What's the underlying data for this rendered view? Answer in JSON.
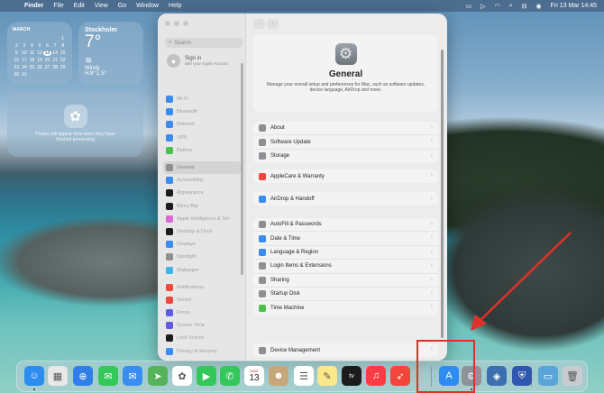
{
  "menubar": {
    "app": "Finder",
    "items": [
      "File",
      "Edit",
      "View",
      "Go",
      "Window",
      "Help"
    ],
    "datetime": "Fri 13 Mar  14:45"
  },
  "calendar_widget": {
    "month": "MARCH",
    "days": [
      "1",
      "2",
      "3",
      "4",
      "5",
      "6",
      "7",
      "8",
      "9",
      "10",
      "11",
      "12",
      "13",
      "14",
      "15",
      "16",
      "17",
      "18",
      "19",
      "20",
      "21",
      "22",
      "23",
      "24",
      "25",
      "26",
      "27",
      "28",
      "29",
      "30",
      "31"
    ],
    "today": "13"
  },
  "weather_widget": {
    "city": "Stockholm",
    "temp": "7°",
    "condition": "Windy",
    "high_low": "H:8° L:5°"
  },
  "photos_widget": {
    "message": "Photos will appear here when they have finished processing"
  },
  "settings": {
    "search_placeholder": "Search",
    "signin": {
      "title": "Sign in",
      "subtitle": "with your Apple Account"
    },
    "sidebar": [
      {
        "label": "Wi-Fi",
        "color": "#3a8cf0"
      },
      {
        "label": "Bluetooth",
        "color": "#3a8cf0"
      },
      {
        "label": "Network",
        "color": "#3a8cf0"
      },
      {
        "label": "VPN",
        "color": "#3a8cf0"
      },
      {
        "label": "Battery",
        "color": "#4cc04f"
      },
      {
        "label": "General",
        "color": "#8e8e93",
        "active": true
      },
      {
        "label": "Accessibility",
        "color": "#3a8cf0"
      },
      {
        "label": "Appearance",
        "color": "#1c1c1e"
      },
      {
        "label": "Menu Bar",
        "color": "#1c1c1e"
      },
      {
        "label": "Apple Intelligence & Siri",
        "color": "#d86bd8"
      },
      {
        "label": "Desktop & Dock",
        "color": "#1c1c1e"
      },
      {
        "label": "Displays",
        "color": "#3a8cf0"
      },
      {
        "label": "Spotlight",
        "color": "#8e8e93"
      },
      {
        "label": "Wallpaper",
        "color": "#40b4e6"
      },
      {
        "label": "Notifications",
        "color": "#f0483e"
      },
      {
        "label": "Sound",
        "color": "#f0483e"
      },
      {
        "label": "Focus",
        "color": "#5e5ce6"
      },
      {
        "label": "Screen Time",
        "color": "#5e5ce6"
      },
      {
        "label": "Lock Screen",
        "color": "#1c1c1e"
      },
      {
        "label": "Privacy & Security",
        "color": "#3a8cf0"
      }
    ],
    "general": {
      "title": "General",
      "description": "Manage your overall setup and preferences for Mac, such as software updates, device language, AirDrop and more."
    },
    "groups": [
      [
        {
          "label": "About",
          "color": "#8e8e93"
        },
        {
          "label": "Software Update",
          "color": "#8e8e93"
        },
        {
          "label": "Storage",
          "color": "#8e8e93"
        }
      ],
      [
        {
          "label": "AppleCare & Warranty",
          "color": "#f0483e"
        }
      ],
      [
        {
          "label": "AirDrop & Handoff",
          "color": "#3a8cf0"
        }
      ],
      [
        {
          "label": "AutoFill & Passwords",
          "color": "#8e8e93"
        },
        {
          "label": "Date & Time",
          "color": "#3a8cf0"
        },
        {
          "label": "Language & Region",
          "color": "#3a8cf0"
        },
        {
          "label": "Login Items & Extensions",
          "color": "#8e8e93"
        },
        {
          "label": "Sharing",
          "color": "#8e8e93"
        },
        {
          "label": "Startup Disk",
          "color": "#8e8e93"
        },
        {
          "label": "Time Machine",
          "color": "#4cc04f"
        }
      ],
      [
        {
          "label": "Device Management",
          "color": "#8e8e93"
        }
      ]
    ]
  },
  "dock": {
    "calendar_month": "MAR",
    "calendar_day": "13",
    "tv_label": "tv",
    "apps": [
      {
        "name": "finder-icon",
        "color": "#2d8cf0",
        "glyph": "☺"
      },
      {
        "name": "launchpad-icon",
        "color": "#e8e8e8",
        "glyph": "▦"
      },
      {
        "name": "safari-icon",
        "color": "#2f7fe8",
        "glyph": "⊕"
      },
      {
        "name": "messages-icon",
        "color": "#34c759",
        "glyph": "✉"
      },
      {
        "name": "mail-icon",
        "color": "#3a8cf0",
        "glyph": "✉"
      },
      {
        "name": "maps-icon",
        "color": "#57b35a",
        "glyph": "➤"
      },
      {
        "name": "photos-icon",
        "color": "#ffffff",
        "glyph": "✿"
      },
      {
        "name": "facetime-icon",
        "color": "#34c759",
        "glyph": "▶"
      },
      {
        "name": "phone-icon",
        "color": "#34c759",
        "glyph": "✆"
      },
      {
        "name": "calendar-icon",
        "color": "#ffffff",
        "glyph": ""
      },
      {
        "name": "contacts-icon",
        "color": "#c7a77a",
        "glyph": "☻"
      },
      {
        "name": "reminders-icon",
        "color": "#ffffff",
        "glyph": "☰"
      },
      {
        "name": "notes-icon",
        "color": "#fbe88a",
        "glyph": "✎"
      },
      {
        "name": "tv-icon",
        "color": "#1c1c1e",
        "glyph": ""
      },
      {
        "name": "music-icon",
        "color": "#fc3c44",
        "glyph": "♫"
      },
      {
        "name": "news-icon",
        "color": "#f3453a",
        "glyph": "➶"
      },
      {
        "name": "app-store-icon",
        "color": "#2e8cf0",
        "glyph": "A"
      },
      {
        "name": "system-settings-icon",
        "color": "#8e9399",
        "glyph": "⚙"
      },
      {
        "name": "vscode-like-icon",
        "color": "#3c6fb0",
        "glyph": "◈"
      },
      {
        "name": "shield-icon",
        "color": "#2f57b0",
        "glyph": "⛨"
      },
      {
        "name": "downloads-folder-icon",
        "color": "#5aa4d8",
        "glyph": "▭"
      },
      {
        "name": "trash-icon",
        "color": "#c8ccd0",
        "glyph": "🗑"
      }
    ]
  }
}
